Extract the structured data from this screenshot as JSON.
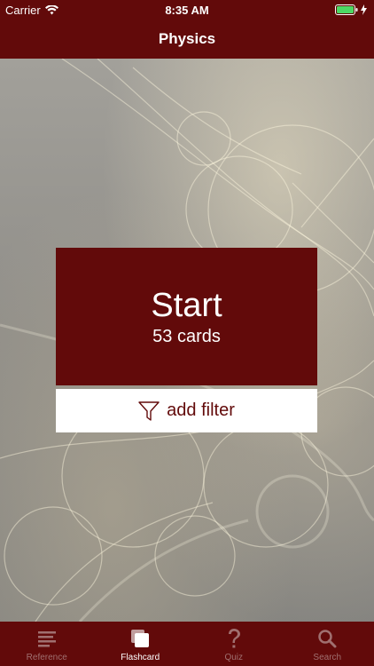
{
  "status_bar": {
    "carrier": "Carrier",
    "time": "8:35 AM"
  },
  "nav": {
    "title": "Physics"
  },
  "start_card": {
    "title": "Start",
    "count": "53 cards"
  },
  "filter": {
    "label": "add filter",
    "icon": "filter-icon"
  },
  "tabs": [
    {
      "label": "Reference",
      "icon": "list-icon",
      "active": false
    },
    {
      "label": "Flashcard",
      "icon": "cards-icon",
      "active": true
    },
    {
      "label": "Quiz",
      "icon": "question-icon",
      "active": false
    },
    {
      "label": "Search",
      "icon": "search-icon",
      "active": false
    }
  ],
  "colors": {
    "brand": "#620a0a",
    "tab_inactive": "#a07070",
    "tab_active": "#ffffff"
  }
}
